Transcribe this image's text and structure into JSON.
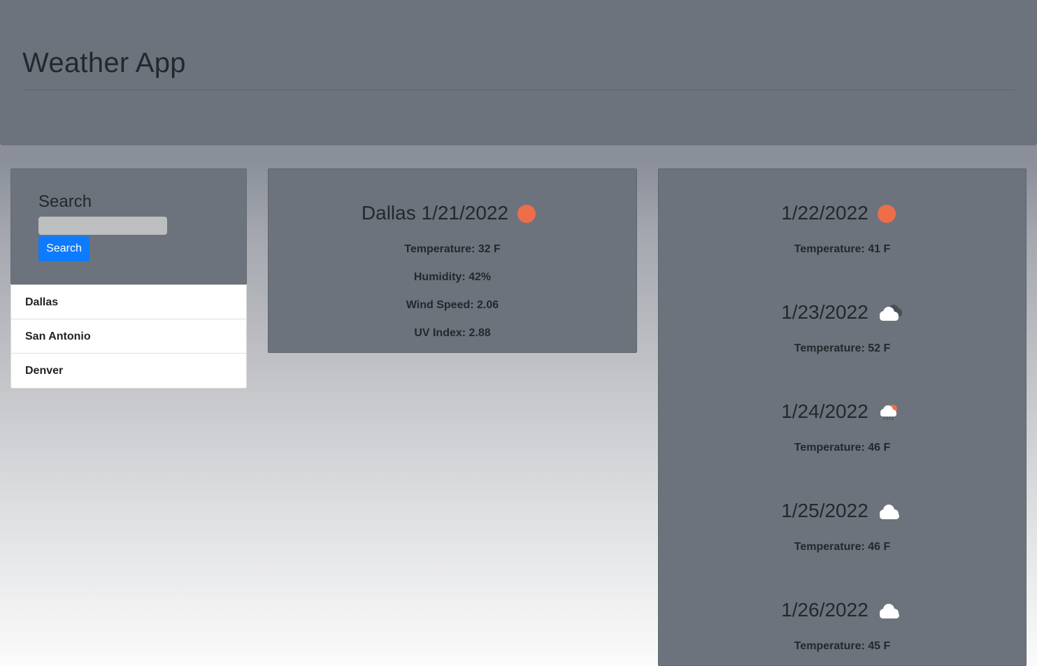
{
  "header": {
    "title": "Weather App"
  },
  "search": {
    "heading": "Search",
    "input_value": "",
    "button_label": "Search"
  },
  "history": [
    {
      "label": "Dallas"
    },
    {
      "label": "San Antonio"
    },
    {
      "label": "Denver"
    }
  ],
  "current": {
    "city": "Dallas",
    "date": "1/21/2022",
    "heading": "Dallas 1/21/2022",
    "icon": "sun-icon",
    "temperature": "Temperature: 32 F",
    "humidity": "Humidity: 42%",
    "wind": "Wind Speed: 2.06",
    "uv": "UV Index: 2.88"
  },
  "forecast": [
    {
      "date": "1/22/2022",
      "icon": "sun-icon",
      "temperature": "Temperature: 41 F"
    },
    {
      "date": "1/23/2022",
      "icon": "broken-clouds-icon",
      "temperature": "Temperature: 52 F"
    },
    {
      "date": "1/24/2022",
      "icon": "rain-icon",
      "temperature": "Temperature: 46 F"
    },
    {
      "date": "1/25/2022",
      "icon": "cloud-icon",
      "temperature": "Temperature: 46 F"
    },
    {
      "date": "1/26/2022",
      "icon": "cloud-icon",
      "temperature": "Temperature: 45 F"
    }
  ],
  "colors": {
    "panel": "#6c737c",
    "accent_button": "#0d7bfd",
    "sun": "#ee6e4a",
    "cloud": "#ffffff",
    "dark_cloud": "#4a4f56"
  }
}
